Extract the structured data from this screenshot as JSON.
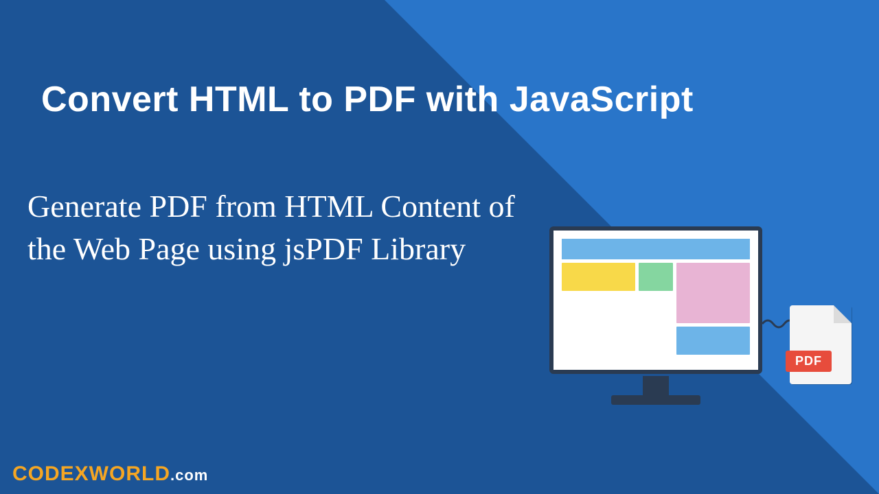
{
  "title": "Convert HTML to PDF with JavaScript",
  "subtitle": "Generate PDF from HTML Content of  the Web Page using  jsPDF Library",
  "logo": {
    "main": "CODEXWORLD",
    "suffix": ".com"
  },
  "pdf_label": "PDF"
}
